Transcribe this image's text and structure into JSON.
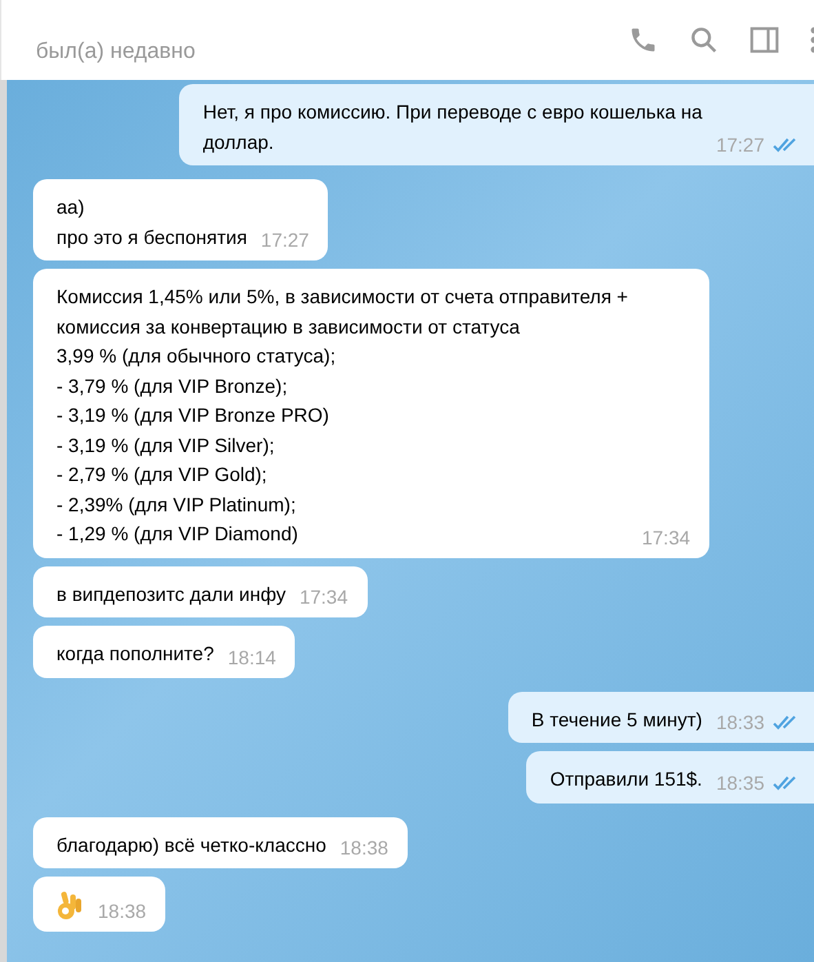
{
  "header": {
    "status": "был(а) недавно"
  },
  "messages": [
    {
      "kind": "text",
      "outgoing": true,
      "text": "Нет, я про комиссию. При переводе с евро кошелька на\nдоллар.",
      "time": "17:27",
      "read": true
    },
    {
      "kind": "text",
      "outgoing": false,
      "text": "аа)\nпро это я беспонятия",
      "time": "17:27"
    },
    {
      "kind": "text",
      "outgoing": false,
      "text": "Комиссия 1,45% или 5%, в зависимости от счета отправителя +\nкомиссия за конвертацию в зависимости от статуса\n3,99 % (для обычного статуса);\n- 3,79 % (для VIP Bronze);\n- 3,19 % (для VIP Bronze PRO)\n- 3,19 % (для VIP Silver);\n- 2,79 % (для VIP Gold);\n- 2,39% (для VIP Platinum);\n- 1,29 % (для VIP Diamond)",
      "time": "17:34"
    },
    {
      "kind": "text",
      "outgoing": false,
      "text": "в випдепозитс дали инфу",
      "time": "17:34"
    },
    {
      "kind": "text",
      "outgoing": false,
      "text": "когда пополните?",
      "time": "18:14"
    },
    {
      "kind": "text",
      "outgoing": true,
      "text": "В течение 5 минут)",
      "time": "18:33",
      "read": true
    },
    {
      "kind": "text",
      "outgoing": true,
      "text": "Отправили 151$.",
      "time": "18:35",
      "read": true
    },
    {
      "kind": "text",
      "outgoing": false,
      "text": "благодарю) всё четко-классно",
      "time": "18:38"
    },
    {
      "kind": "emoji",
      "outgoing": false,
      "time": "18:38"
    }
  ]
}
